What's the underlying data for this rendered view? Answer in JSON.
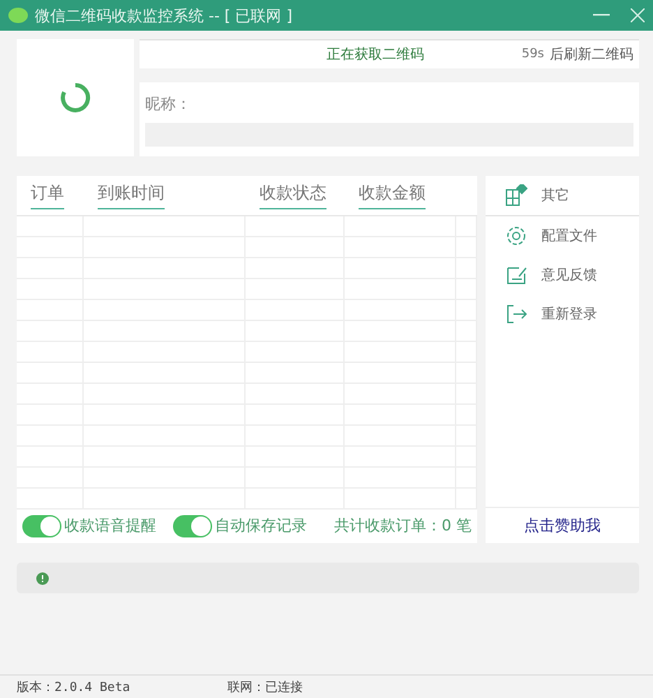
{
  "window": {
    "title": "微信二维码收款监控系统  -- [ 已联网 ]"
  },
  "qr": {
    "loading": true
  },
  "status": {
    "message": "正在获取二维码",
    "countdown": "59s",
    "refresh_label": "后刷新二维码"
  },
  "profile": {
    "nickname_label": "昵称："
  },
  "table": {
    "columns": [
      "订单",
      "到账时间",
      "收款状态",
      "收款金额"
    ]
  },
  "menu": [
    {
      "label": "其它"
    },
    {
      "label": "配置文件"
    },
    {
      "label": "意见反馈"
    },
    {
      "label": "重新登录"
    }
  ],
  "toggles": [
    {
      "label": "收款语音提醒",
      "on": true
    },
    {
      "label": "自动保存记录",
      "on": true
    }
  ],
  "order_count": "共计收款订单：0 笔",
  "sponsor": "点击赞助我",
  "status_bar": {
    "version": "版本：2.0.4 Beta",
    "network": "联网：已连接"
  }
}
